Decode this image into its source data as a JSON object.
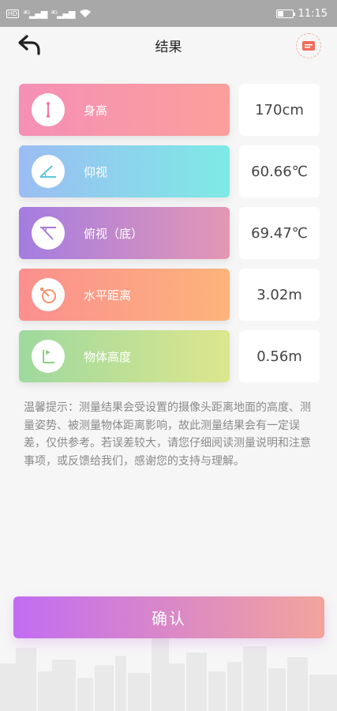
{
  "status_bar": {
    "network_tag": "HD",
    "signal_1": "⁴ᴳ",
    "signal_2": "⁴ᴳ",
    "time": "11:15"
  },
  "nav": {
    "title": "结果"
  },
  "rows": [
    {
      "label": "身高",
      "value": "170cm",
      "icon": "height-icon"
    },
    {
      "label": "仰视",
      "value": "60.66℃",
      "icon": "elevation-angle-icon"
    },
    {
      "label": "俯视（底）",
      "value": "69.47℃",
      "icon": "depression-angle-icon"
    },
    {
      "label": "水平距离",
      "value": "3.02m",
      "icon": "horizontal-distance-icon"
    },
    {
      "label": "物体高度",
      "value": "0.56m",
      "icon": "object-height-icon"
    }
  ],
  "tip": "温馨提示：测量结果会受设置的摄像头距离地面的高度、测量姿势、被测量物体距离影响，故此测量结果会有一定误差，仅供参考。若误差较大，请您仔细阅读测量说明和注意事项，或反馈给我们，感谢您的支持与理解。",
  "confirm_label": "确认",
  "colors": {
    "accent_start": "#c26cf2",
    "accent_end": "#f2a49c"
  }
}
